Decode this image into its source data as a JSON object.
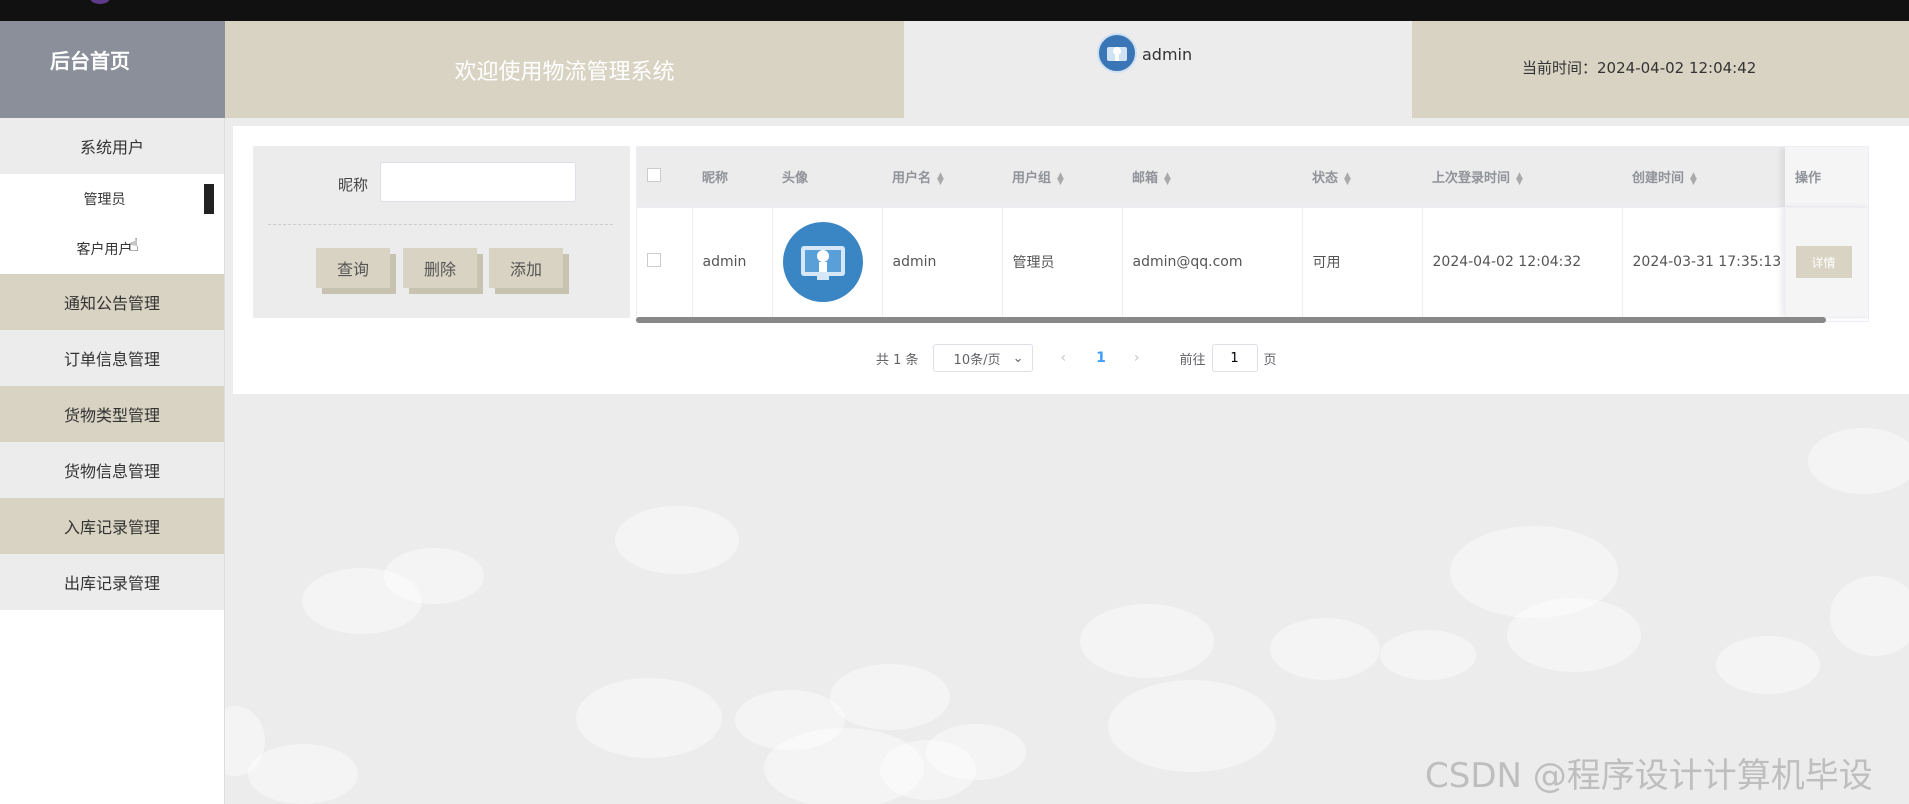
{
  "header": {
    "brand": "后台首页",
    "welcome": "欢迎使用物流管理系统",
    "username": "admin",
    "time_label": "当前时间：",
    "time_value": "2024-04-02 12:04:42"
  },
  "sidebar": {
    "items": [
      {
        "label": "系统用户",
        "style": "light"
      },
      {
        "label": "管理员",
        "sub": true,
        "active": true
      },
      {
        "label": "客户用户",
        "sub": true
      },
      {
        "label": "通知公告管理",
        "style": "tan"
      },
      {
        "label": "订单信息管理",
        "style": "light"
      },
      {
        "label": "货物类型管理",
        "style": "tan"
      },
      {
        "label": "货物信息管理",
        "style": "light"
      },
      {
        "label": "入库记录管理",
        "style": "tan"
      },
      {
        "label": "出库记录管理",
        "style": "light"
      }
    ]
  },
  "search": {
    "label": "昵称",
    "placeholder": "",
    "buttons": {
      "query": "查询",
      "delete": "删除",
      "add": "添加"
    }
  },
  "table": {
    "columns": [
      "昵称",
      "头像",
      "用户名",
      "用户组",
      "邮箱",
      "状态",
      "上次登录时间",
      "创建时间",
      "操作"
    ],
    "rows": [
      {
        "nickname": "admin",
        "username": "admin",
        "group": "管理员",
        "email": "admin@qq.com",
        "status": "可用",
        "last_login": "2024-04-02 12:04:32",
        "created": "2024-03-31 17:35:13",
        "action": "详情"
      }
    ]
  },
  "pager": {
    "total": "共 1 条",
    "size": "10条/页",
    "page": "1",
    "goto_label": "前往",
    "goto_value": "1",
    "page_suffix": "页"
  },
  "watermark": "CSDN @程序设计计算机毕设"
}
